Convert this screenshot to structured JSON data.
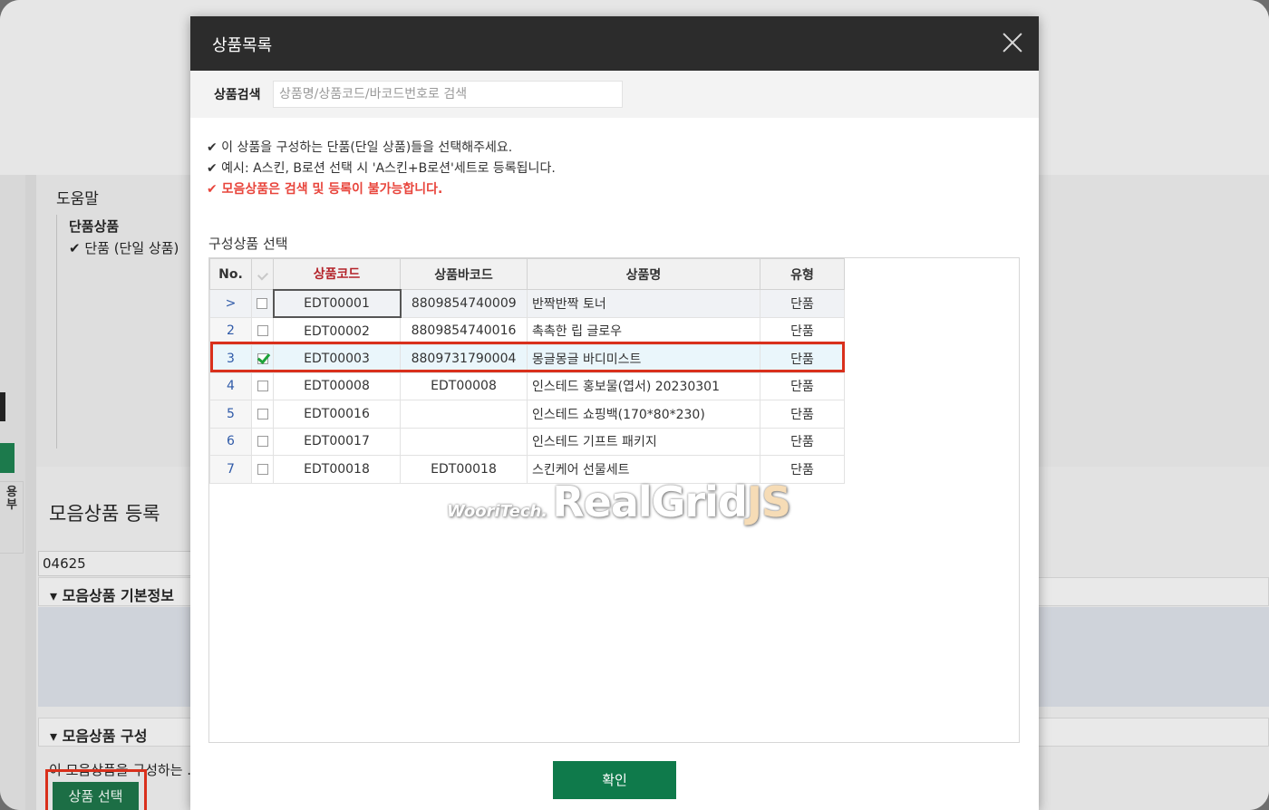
{
  "background": {
    "side_label": "용\n부",
    "help_title": "도움말",
    "help_subtitle": "단품상품",
    "help_item": "✔ 단품 (단일 상품)",
    "page_title": "모음상품 등록",
    "code_value": "04625",
    "section_basic": "▾ 모음상품 기본정보",
    "section_compose": "▾ 모음상품 구성",
    "compose_desc": "이 모음상품을 구성하는 ...",
    "select_button": "상품 선택"
  },
  "modal": {
    "title": "상품목록",
    "search_label": "상품검색",
    "search_placeholder": "상품명/상품코드/바코드번호로 검색",
    "notices": [
      "✔ 이 상품을 구성하는 단품(단일 상품)들을 선택해주세요.",
      "✔ 예시: A스킨, B로션 선택 시 'A스킨+B로션'세트로 등록됩니다.",
      "✔ 모음상품은 검색 및 등록이 불가능합니다."
    ],
    "grid_label": "구성상품 선택",
    "columns": [
      "No.",
      "상품코드",
      "상품바코드",
      "상품명",
      "유형"
    ],
    "rows": [
      {
        "no": ">",
        "checked": false,
        "code": "EDT00001",
        "barcode": "8809854740009",
        "name": "반짝반짝 토너",
        "type": "단품"
      },
      {
        "no": "2",
        "checked": false,
        "code": "EDT00002",
        "barcode": "8809854740016",
        "name": "촉촉한 립 글로우",
        "type": "단품"
      },
      {
        "no": "3",
        "checked": true,
        "code": "EDT00003",
        "barcode": "8809731790004",
        "name": " 몽글몽글 바디미스트",
        "type": "단품"
      },
      {
        "no": "4",
        "checked": false,
        "code": "EDT00008",
        "barcode": "EDT00008",
        "name": "인스테드 홍보물(엽서) 20230301",
        "type": "단품"
      },
      {
        "no": "5",
        "checked": false,
        "code": "EDT00016",
        "barcode": "",
        "name": "인스테드 쇼핑백(170*80*230)",
        "type": "단품"
      },
      {
        "no": "6",
        "checked": false,
        "code": "EDT00017",
        "barcode": "",
        "name": "인스테드 기프트 패키지",
        "type": "단품"
      },
      {
        "no": "7",
        "checked": false,
        "code": "EDT00018",
        "barcode": "EDT00018",
        "name": "스킨케어 선물세트",
        "type": "단품"
      }
    ],
    "watermark_brand": "WooriTech.",
    "watermark_product": "RealGrid",
    "watermark_suffix": "JS",
    "confirm_button": "확인"
  },
  "colors": {
    "header_bg": "#2c2c2c",
    "confirm_bg": "#0f7a4b",
    "highlight_border": "#d9301c",
    "warning_text": "#e8453c",
    "code_header_text": "#b4232a"
  }
}
